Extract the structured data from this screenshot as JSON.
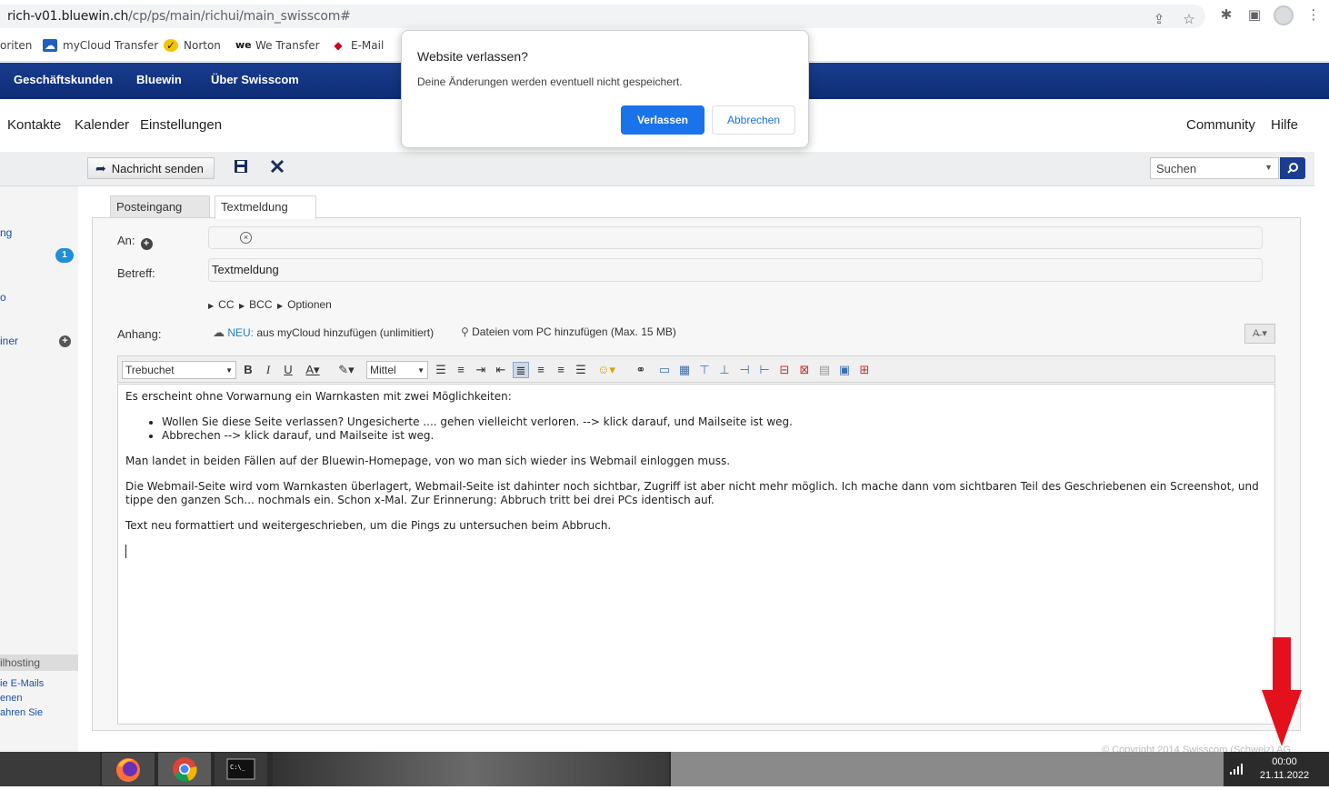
{
  "browser": {
    "url_host": "rich-v01.bluewin.ch",
    "url_path": "/cp/ps/main/richui/main_swisscom#",
    "icons": [
      "share-icon",
      "star-icon",
      "extensions-icon",
      "sidepanel-icon",
      "profile-icon",
      "kebab-menu-icon"
    ]
  },
  "bookmarks": {
    "favorites": "oriten",
    "mycloud": "myCloud Transfer",
    "norton": "Norton",
    "wetransfer": "We Transfer",
    "email": "E-Mail"
  },
  "navbar": {
    "business": "Geschäftskunden",
    "bluewin": "Bluewin",
    "about": "Über Swisscom"
  },
  "menubar": {
    "contacts": "Kontakte",
    "calendar": "Kalender",
    "settings": "Einstellungen",
    "community": "Community",
    "help": "Hilfe"
  },
  "toolbar": {
    "send": "Nachricht senden",
    "search_placeholder": "Suchen"
  },
  "sidebar": {
    "item_inbox": "ng",
    "badge": "1",
    "item_p": "o",
    "item_ordner": "iner",
    "section": "ilhosting",
    "link1": "ie E-Mails",
    "link2": "enen",
    "link3": "ahren Sie"
  },
  "tabs": {
    "inbox": "Posteingang",
    "compose": "Textmeldung"
  },
  "compose": {
    "to_label": "An:",
    "subject_label": "Betreff:",
    "subject_value": "Textmeldung",
    "cc": "CC",
    "bcc": "BCC",
    "options": "Optionen",
    "attach_label": "Anhang:",
    "attach_neu": "NEU:",
    "attach_cloud": "aus myCloud hinzufügen (unlimitiert)",
    "attach_pc": "Dateien vom PC hinzufügen (Max. 15 MB)"
  },
  "rte": {
    "font": "Trebuchet",
    "size": "Mittel"
  },
  "editor": {
    "p1": "Es erscheint ohne Vorwarnung ein Warnkasten mit zwei Möglichkeiten:",
    "li1": "Wollen Sie diese Seite verlassen? Ungesicherte .... gehen vielleicht verloren.  --> klick darauf, und Mailseite ist weg.",
    "li2": "Abbrechen  --> klick darauf, und Mailseite ist weg.",
    "p2": "Man landet in beiden Fällen auf der Bluewin-Homepage, von wo man sich wieder ins Webmail einloggen muss.",
    "p3": "Die Webmail-Seite wird vom Warnkasten überlagert, Webmail-Seite ist dahinter noch sichtbar, Zugriff ist aber nicht mehr möglich. Ich mache dann vom sichtbaren Teil des Geschriebenen ein Screenshot, und tippe den ganzen Sch... nochmals ein. Schon x-Mal. Zur Erinnerung: Abbruch tritt bei drei PCs identisch auf.",
    "p4": "Text neu formattiert und weitergeschrieben, um die Pings zu untersuchen beim Abbruch."
  },
  "footer": {
    "copyright": "© Copyright 2014 Swisscom (Schweiz) AG"
  },
  "taskbar": {
    "time": "00:00",
    "date": "21.11.2022"
  },
  "dialog": {
    "title": "Website verlassen?",
    "message": "Deine Änderungen werden eventuell nicht gespeichert.",
    "leave": "Verlassen",
    "cancel": "Abbrechen"
  },
  "colors": {
    "swisscom_blue": "#0d2c75",
    "chrome_blue": "#1a73e8",
    "annotation_red": "#e3111b"
  }
}
